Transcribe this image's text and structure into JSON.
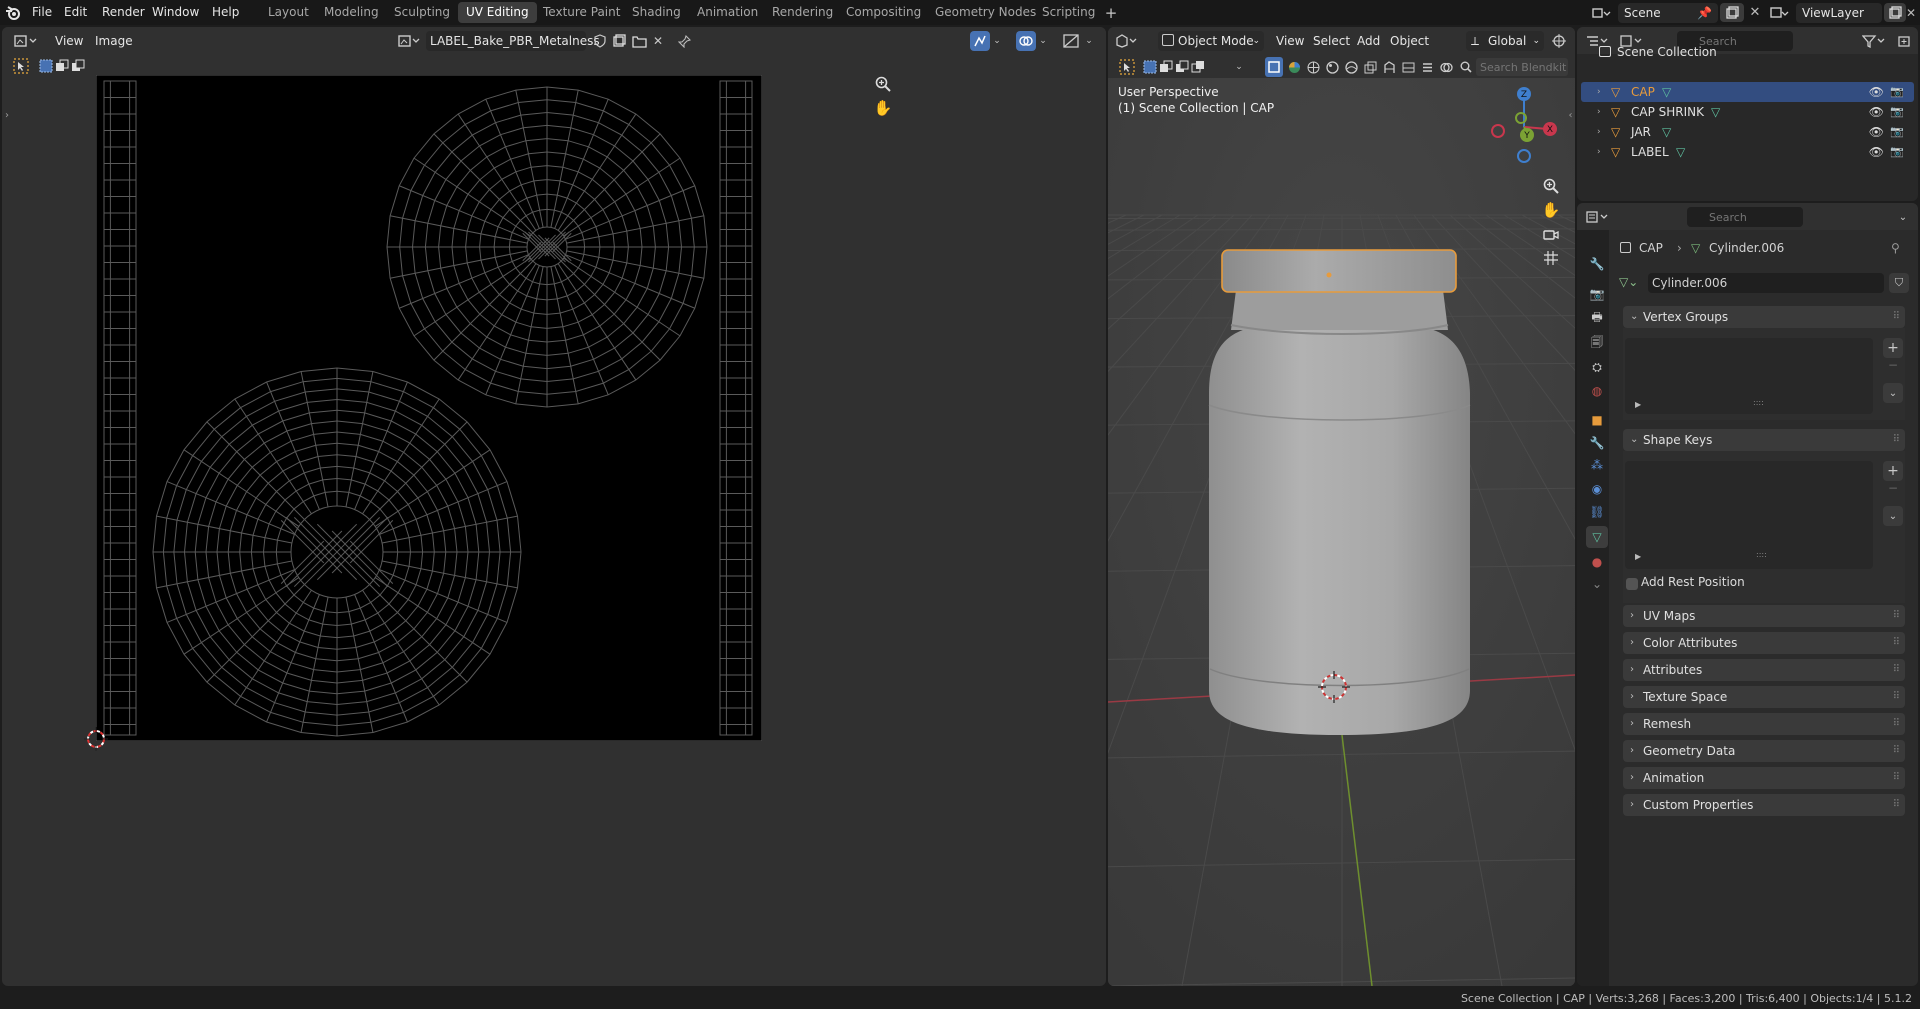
{
  "menu": {
    "items": [
      "File",
      "Edit",
      "Render",
      "Window",
      "Help"
    ]
  },
  "workspaces": [
    "Layout",
    "Modeling",
    "Sculpting",
    "UV Editing",
    "Texture Paint",
    "Shading",
    "Animation",
    "Rendering",
    "Compositing",
    "Geometry Nodes",
    "Scripting"
  ],
  "active_workspace": "UV Editing",
  "scene": {
    "name": "Scene",
    "view_layer": "ViewLayer"
  },
  "uv_editor": {
    "view_menu": "View",
    "image_menu": "Image",
    "image_name": "LABEL_Bake_PBR_Metalness"
  },
  "viewport": {
    "mode": "Object Mode",
    "menus": [
      "View",
      "Select",
      "Add",
      "Object"
    ],
    "orientation": "Global",
    "search_placeholder": "Search Blendkit",
    "info_line1": "User Perspective",
    "info_line2": "(1) Scene Collection | CAP",
    "gizmo_x": "X",
    "gizmo_y": "Y",
    "gizmo_z": "Z"
  },
  "outliner": {
    "search_placeholder": "Search",
    "collection": "Scene Collection",
    "objects": [
      {
        "name": "CAP",
        "selected": true
      },
      {
        "name": "CAP SHRINK",
        "selected": false
      },
      {
        "name": "JAR",
        "selected": false
      },
      {
        "name": "LABEL",
        "selected": false
      }
    ]
  },
  "properties": {
    "search_placeholder": "Search",
    "breadcrumb_object": "CAP",
    "breadcrumb_mesh": "Cylinder.006",
    "mesh_name": "Cylinder.006",
    "panels_open": [
      "Vertex Groups",
      "Shape Keys"
    ],
    "add_rest_position": "Add Rest Position",
    "panels_closed": [
      "UV Maps",
      "Color Attributes",
      "Attributes",
      "Texture Space",
      "Remesh",
      "Geometry Data",
      "Animation",
      "Custom Properties"
    ]
  },
  "statusbar": {
    "text": "Scene Collection | CAP | Verts:3,268 | Faces:3,200 | Tris:6,400 | Objects:1/4 | 5.1.2"
  },
  "colors": {
    "accent": "#4772b3",
    "selected_object": "#e79b3c",
    "active_row": "#334d80",
    "axis_x": "#c8374d",
    "axis_y": "#7ba234",
    "axis_z": "#3f7fce"
  }
}
